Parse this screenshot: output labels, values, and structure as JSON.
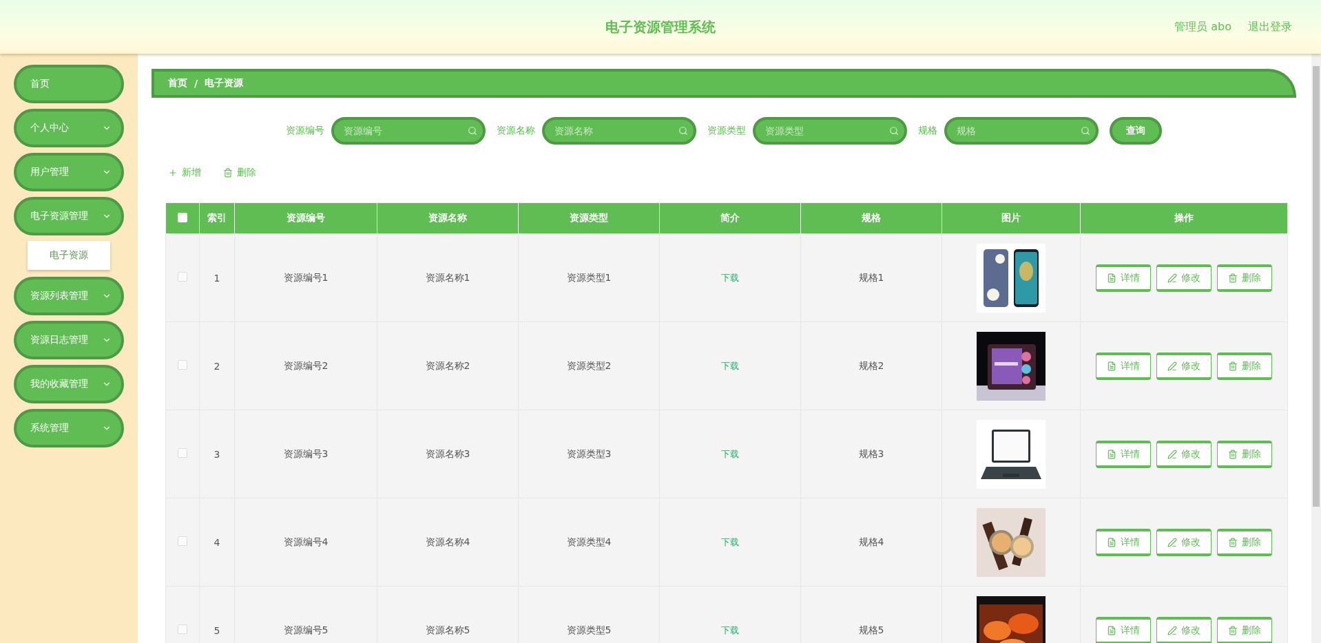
{
  "header": {
    "title": "电子资源管理系统",
    "user": "管理员 abo",
    "logout": "退出登录"
  },
  "sidebar": {
    "items": [
      {
        "kind": "link",
        "label": "首页"
      },
      {
        "kind": "group",
        "label": "个人中心",
        "expanded": false
      },
      {
        "kind": "group",
        "label": "用户管理",
        "expanded": false
      },
      {
        "kind": "group",
        "label": "电子资源管理",
        "expanded": true,
        "children": [
          {
            "label": "电子资源"
          }
        ]
      },
      {
        "kind": "group",
        "label": "资源列表管理",
        "expanded": false
      },
      {
        "kind": "group",
        "label": "资源日志管理",
        "expanded": false
      },
      {
        "kind": "group",
        "label": "我的收藏管理",
        "expanded": false
      },
      {
        "kind": "group",
        "label": "系统管理",
        "expanded": false
      }
    ]
  },
  "breadcrumb": {
    "items": [
      "首页",
      "电子资源"
    ],
    "separator": "/"
  },
  "search": {
    "fields": [
      {
        "label": "资源编号",
        "placeholder": "资源编号"
      },
      {
        "label": "资源名称",
        "placeholder": "资源名称"
      },
      {
        "label": "资源类型",
        "placeholder": "资源类型"
      },
      {
        "label": "规格",
        "placeholder": "规格"
      }
    ],
    "button": "查询"
  },
  "toolbar": [
    {
      "kind": "add",
      "label": "新增"
    },
    {
      "kind": "delete",
      "label": "删除"
    }
  ],
  "table": {
    "select_all": {
      "checked": false
    },
    "columns": [
      "索引",
      "资源编号",
      "资源名称",
      "资源类型",
      "简介",
      "规格",
      "图片",
      "操作"
    ],
    "rows": [
      {
        "checked": false,
        "index": "1",
        "code": "资源编号1",
        "name": "资源名称1",
        "type": "资源类型1",
        "intro": "下载",
        "spec": "规格1",
        "image": {
          "kind": "picture"
        },
        "actions": [
          {
            "kind": "detail",
            "label": "详情"
          },
          {
            "kind": "edit",
            "label": "修改"
          },
          {
            "kind": "delete",
            "label": "删除"
          }
        ]
      },
      {
        "checked": false,
        "index": "2",
        "code": "资源编号2",
        "name": "资源名称2",
        "type": "资源类型2",
        "intro": "下载",
        "spec": "规格2",
        "image": {
          "kind": "picture"
        },
        "actions": [
          {
            "kind": "detail",
            "label": "详情"
          },
          {
            "kind": "edit",
            "label": "修改"
          },
          {
            "kind": "delete",
            "label": "删除"
          }
        ]
      },
      {
        "checked": false,
        "index": "3",
        "code": "资源编号3",
        "name": "资源名称3",
        "type": "资源类型3",
        "intro": "下载",
        "spec": "规格3",
        "image": {
          "kind": "picture"
        },
        "actions": [
          {
            "kind": "detail",
            "label": "详情"
          },
          {
            "kind": "edit",
            "label": "修改"
          },
          {
            "kind": "delete",
            "label": "删除"
          }
        ]
      },
      {
        "checked": false,
        "index": "4",
        "code": "资源编号4",
        "name": "资源名称4",
        "type": "资源类型4",
        "intro": "下载",
        "spec": "规格4",
        "image": {
          "kind": "picture"
        },
        "actions": [
          {
            "kind": "detail",
            "label": "详情"
          },
          {
            "kind": "edit",
            "label": "修改"
          },
          {
            "kind": "delete",
            "label": "删除"
          }
        ]
      },
      {
        "checked": false,
        "index": "5",
        "code": "资源编号5",
        "name": "资源名称5",
        "type": "资源类型5",
        "intro": "下载",
        "spec": "规格5",
        "image": {
          "kind": "picture"
        },
        "actions": [
          {
            "kind": "detail",
            "label": "详情"
          },
          {
            "kind": "edit",
            "label": "修改"
          },
          {
            "kind": "delete",
            "label": "删除"
          }
        ]
      }
    ]
  }
}
